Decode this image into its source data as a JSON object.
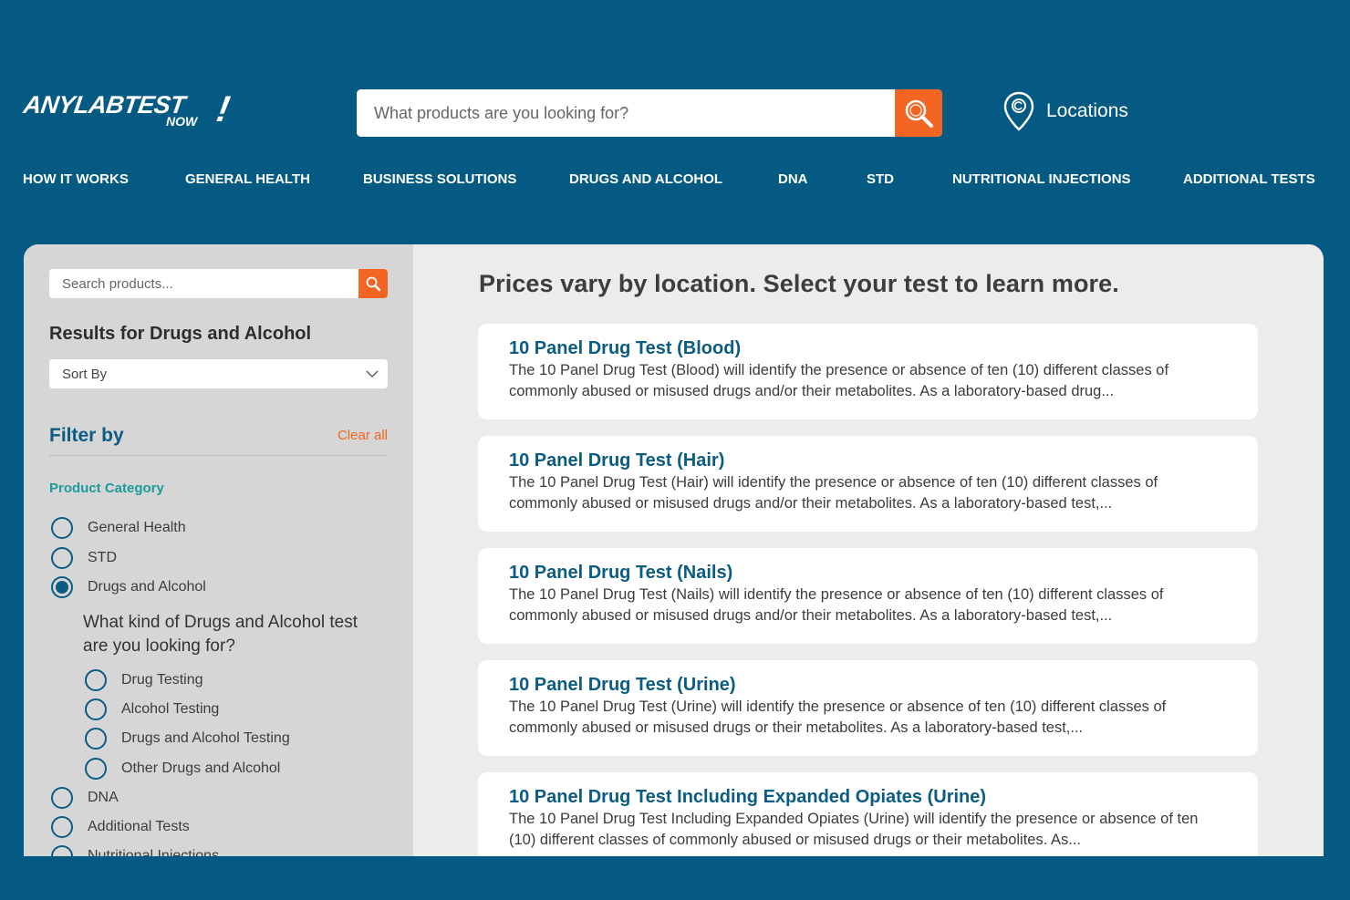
{
  "brand": {
    "logo_main": "ANYLABTEST",
    "logo_sub": "NOW",
    "logo_bang": "!"
  },
  "header": {
    "search_placeholder": "What products are you looking for?",
    "locations_label": "Locations"
  },
  "nav": [
    "HOW IT WORKS",
    "GENERAL HEALTH",
    "BUSINESS SOLUTIONS",
    "DRUGS AND ALCOHOL",
    "DNA",
    "STD",
    "NUTRITIONAL INJECTIONS",
    "ADDITIONAL TESTS"
  ],
  "sidebar": {
    "search_placeholder": "Search products...",
    "results_title": "Results for Drugs and Alcohol",
    "sort_label": "Sort By",
    "filter_title": "Filter by",
    "clear_all": "Clear all",
    "category_title": "Product Category",
    "categories": [
      {
        "label": "General Health",
        "checked": false
      },
      {
        "label": "STD",
        "checked": false
      },
      {
        "label": "Drugs and Alcohol",
        "checked": true
      },
      {
        "label": "DNA",
        "checked": false
      },
      {
        "label": "Additional Tests",
        "checked": false
      },
      {
        "label": "Nutritional Injections",
        "checked": false
      }
    ],
    "sub_question": "What kind of Drugs and Alcohol test are you looking for?",
    "sub_options": [
      {
        "label": "Drug Testing",
        "checked": false
      },
      {
        "label": "Alcohol Testing",
        "checked": false
      },
      {
        "label": "Drugs and Alcohol Testing",
        "checked": false
      },
      {
        "label": "Other Drugs and Alcohol",
        "checked": false
      }
    ]
  },
  "content": {
    "title": "Prices vary by location. Select your test to learn more.",
    "products": [
      {
        "name": "10 Panel Drug Test (Blood)",
        "description": "The 10 Panel Drug Test (Blood) will identify the presence or absence of ten (10) different classes of commonly abused or misused drugs and/or their metabolites. As a laboratory-based drug..."
      },
      {
        "name": "10 Panel Drug Test (Hair)",
        "description": "The 10 Panel Drug Test (Hair) will identify the presence or absence of ten (10) different classes of commonly abused or misused drugs and/or their metabolites.  As a laboratory-based test,..."
      },
      {
        "name": "10 Panel Drug Test (Nails)",
        "description": "The 10 Panel Drug Test (Nails) will identify the presence or absence of ten (10) different classes of commonly abused or misused drugs and/or their metabolites.  As a laboratory-based test,..."
      },
      {
        "name": "10 Panel Drug Test (Urine)",
        "description": "The 10 Panel Drug Test (Urine)  will identify the presence or absence of ten (10) different classes of commonly abused or misused drugs or their metabolites.  As a laboratory-based test,..."
      },
      {
        "name": "10 Panel Drug Test Including Expanded Opiates (Urine)",
        "description": "The 10 Panel Drug Test Including Expanded Opiates (Urine) will identify the presence or absence of ten (10) different classes of commonly abused or misused drugs or their metabolites.  As..."
      }
    ]
  },
  "icons": {
    "search": "search-icon",
    "location": "map-pin-icon",
    "sort": "chevron-down-icon"
  },
  "colors": {
    "primary": "#045a82",
    "accent": "#f26522",
    "teal": "#1a9c9a"
  }
}
